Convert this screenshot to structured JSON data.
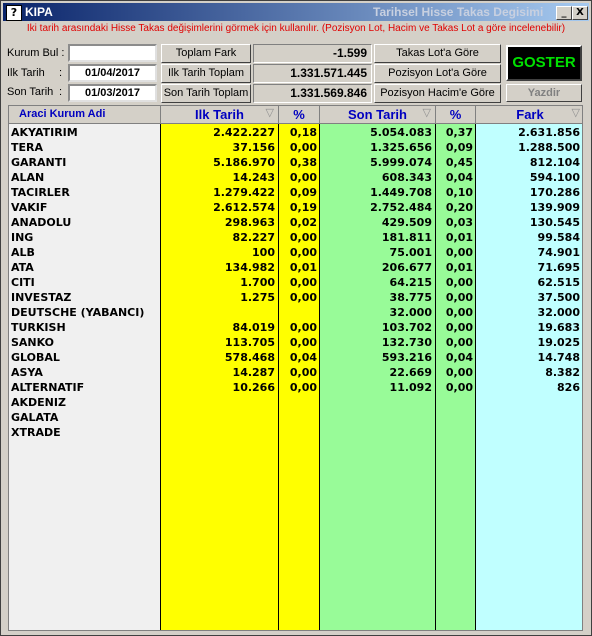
{
  "window": {
    "title": "KIPA",
    "subtitle": "Tarihsel Hisse Takas Degisimi",
    "minimize": "_",
    "close": "X",
    "icon": "?"
  },
  "info_text": "Iki tarih arasındaki Hisse Takas değişimlerini görmek için kullanılır. (Pozisyon Lot, Hacim ve Takas Lot a göre incelenebilir)",
  "filters": {
    "kurum_bul_label": "Kurum Bul :",
    "kurum_bul_value": "",
    "ilk_tarih_label": "Ilk Tarih",
    "ilk_tarih_colon": ":",
    "ilk_tarih_value": "01/04/2017",
    "son_tarih_label": "Son Tarih",
    "son_tarih_colon": ":",
    "son_tarih_value": "01/03/2017"
  },
  "totals": {
    "toplam_fark_label": "Toplam Fark",
    "toplam_fark_value": "-1.599",
    "ilk_tarih_toplam_label": "Ilk Tarih Toplam",
    "ilk_tarih_toplam_value": "1.331.571.445",
    "son_tarih_toplam_label": "Son Tarih Toplam",
    "son_tarih_toplam_value": "1.331.569.846"
  },
  "modes": {
    "takas_lot": "Takas Lot'a Göre",
    "pozisyon_lot": "Pozisyon Lot'a Göre",
    "pozisyon_hacim": "Pozisyon Hacim'e Göre"
  },
  "actions": {
    "goster": "GOSTER",
    "yazdir": "Yazdir"
  },
  "table": {
    "headers": {
      "kurum": "Araci Kurum Adi",
      "ilk": "Ilk Tarih",
      "ilk_pct": "%",
      "son": "Son Tarih",
      "son_pct": "%",
      "fark": "Fark"
    },
    "rows": [
      {
        "name": "AKYATIRIM",
        "ilk": "2.422.227",
        "ilk_pct": "0,18",
        "son": "5.054.083",
        "son_pct": "0,37",
        "fark": "2.631.856"
      },
      {
        "name": "TERA",
        "ilk": "37.156",
        "ilk_pct": "0,00",
        "son": "1.325.656",
        "son_pct": "0,09",
        "fark": "1.288.500"
      },
      {
        "name": "GARANTI",
        "ilk": "5.186.970",
        "ilk_pct": "0,38",
        "son": "5.999.074",
        "son_pct": "0,45",
        "fark": "812.104"
      },
      {
        "name": "ALAN",
        "ilk": "14.243",
        "ilk_pct": "0,00",
        "son": "608.343",
        "son_pct": "0,04",
        "fark": "594.100"
      },
      {
        "name": "TACIRLER",
        "ilk": "1.279.422",
        "ilk_pct": "0,09",
        "son": "1.449.708",
        "son_pct": "0,10",
        "fark": "170.286"
      },
      {
        "name": "VAKIF",
        "ilk": "2.612.574",
        "ilk_pct": "0,19",
        "son": "2.752.484",
        "son_pct": "0,20",
        "fark": "139.909"
      },
      {
        "name": "ANADOLU",
        "ilk": "298.963",
        "ilk_pct": "0,02",
        "son": "429.509",
        "son_pct": "0,03",
        "fark": "130.545"
      },
      {
        "name": "ING",
        "ilk": "82.227",
        "ilk_pct": "0,00",
        "son": "181.811",
        "son_pct": "0,01",
        "fark": "99.584"
      },
      {
        "name": "ALB",
        "ilk": "100",
        "ilk_pct": "0,00",
        "son": "75.001",
        "son_pct": "0,00",
        "fark": "74.901"
      },
      {
        "name": "ATA",
        "ilk": "134.982",
        "ilk_pct": "0,01",
        "son": "206.677",
        "son_pct": "0,01",
        "fark": "71.695"
      },
      {
        "name": "CITI",
        "ilk": "1.700",
        "ilk_pct": "0,00",
        "son": "64.215",
        "son_pct": "0,00",
        "fark": "62.515"
      },
      {
        "name": "INVESTAZ",
        "ilk": "1.275",
        "ilk_pct": "0,00",
        "son": "38.775",
        "son_pct": "0,00",
        "fark": "37.500"
      },
      {
        "name": "DEUTSCHE (YABANCI)",
        "ilk": "",
        "ilk_pct": "",
        "son": "32.000",
        "son_pct": "0,00",
        "fark": "32.000"
      },
      {
        "name": "TURKISH",
        "ilk": "84.019",
        "ilk_pct": "0,00",
        "son": "103.702",
        "son_pct": "0,00",
        "fark": "19.683"
      },
      {
        "name": "SANKO",
        "ilk": "113.705",
        "ilk_pct": "0,00",
        "son": "132.730",
        "son_pct": "0,00",
        "fark": "19.025"
      },
      {
        "name": "GLOBAL",
        "ilk": "578.468",
        "ilk_pct": "0,04",
        "son": "593.216",
        "son_pct": "0,04",
        "fark": "14.748"
      },
      {
        "name": "ASYA",
        "ilk": "14.287",
        "ilk_pct": "0,00",
        "son": "22.669",
        "son_pct": "0,00",
        "fark": "8.382"
      },
      {
        "name": "ALTERNATIF",
        "ilk": "10.266",
        "ilk_pct": "0,00",
        "son": "11.092",
        "son_pct": "0,00",
        "fark": "826"
      },
      {
        "name": "AKDENIZ",
        "ilk": "",
        "ilk_pct": "",
        "son": "",
        "son_pct": "",
        "fark": ""
      },
      {
        "name": "GALATA",
        "ilk": "",
        "ilk_pct": "",
        "son": "",
        "son_pct": "",
        "fark": ""
      },
      {
        "name": "XTRADE",
        "ilk": "",
        "ilk_pct": "",
        "son": "",
        "son_pct": "",
        "fark": ""
      }
    ]
  },
  "colors": {
    "titlebar_start": "#0a246a",
    "info_text": "#e00000",
    "header_text": "#0000c0",
    "col_kurum": "#f0f0f0",
    "col_ilk": "#ffff00",
    "col_son": "#98fb98",
    "col_fark": "#c0ffff",
    "goster_bg": "#000000",
    "goster_text": "#00e000"
  }
}
